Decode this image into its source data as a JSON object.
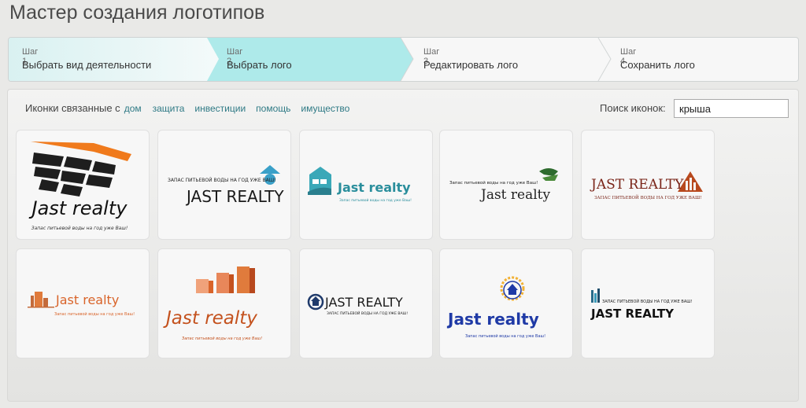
{
  "title": "Мастер создания логотипов",
  "steps": [
    {
      "num": "Шаг 1",
      "label": "Выбрать вид деятельности"
    },
    {
      "num": "Шаг 2",
      "label": "Выбрать лого"
    },
    {
      "num": "Шаг 3",
      "label": "Редактировать лого"
    },
    {
      "num": "Шаг 4",
      "label": "Сохранить лого"
    }
  ],
  "filter": {
    "prefix": "Иконки связанные с",
    "tags": [
      "дом",
      "защита",
      "инвестиции",
      "помощь",
      "имущество"
    ]
  },
  "search": {
    "label": "Поиск иконок:",
    "value": "крыша"
  },
  "logos": [
    {
      "name": "Jast realty",
      "tagline": "Запас питьевой воды на год уже Ваш!"
    },
    {
      "name": "JAST REALTY",
      "tagline": "ЗАПАС ПИТЬЕВОЙ ВОДЫ НА ГОД УЖЕ ВАШ!"
    },
    {
      "name": "Jast realty",
      "tagline": "Запас питьевой воды на год уже Ваш!"
    },
    {
      "name": "Jast realty",
      "tagline": "Запас питьевой воды на год уже Ваш!"
    },
    {
      "name": "JAST REALTY",
      "tagline": "ЗАПАС ПИТЬЕВОЙ ВОДЫ НА ГОД УЖЕ ВАШ!"
    },
    {
      "name": "Jast realty",
      "tagline": "Запас питьевой воды на год уже Ваш!"
    },
    {
      "name": "Jast realty",
      "tagline": "Запас питьевой воды на год уже Ваш!"
    },
    {
      "name": "JAST REALTY",
      "tagline": "ЗАПАС ПИТЬЕВОЙ ВОДЫ НА ГОД УЖЕ ВАШ!"
    },
    {
      "name": "Jast realty",
      "tagline": "Запас питьевой воды на год уже Ваш!"
    },
    {
      "name": "JAST REALTY",
      "tagline": "ЗАПАС ПИТЬЕВОЙ ВОДЫ НА ГОД УЖЕ ВАШ!"
    }
  ],
  "colors": {
    "active_step": "#aeeaea",
    "accent_link": "#2f7a85"
  }
}
